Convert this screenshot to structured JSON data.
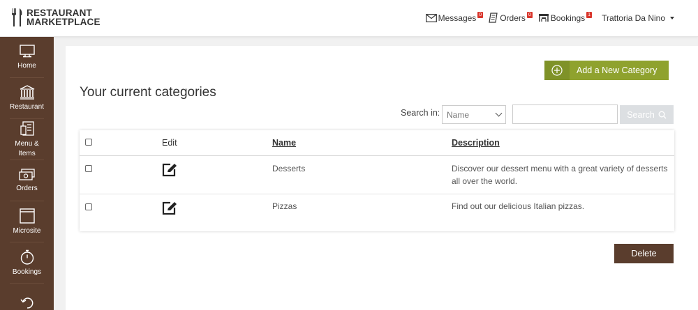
{
  "brand": {
    "line1": "RESTAURANT",
    "line2": "MARKETPLACE"
  },
  "topnav": {
    "messages": {
      "label": "Messages",
      "count": "0"
    },
    "orders": {
      "label": "Orders",
      "count": "0"
    },
    "bookings": {
      "label": "Bookings",
      "count": "1"
    },
    "user": "Trattoria Da Nino"
  },
  "sidebar": {
    "items": [
      {
        "label": "Home",
        "icon": "monitor-icon"
      },
      {
        "label": "Restaurant",
        "icon": "building-icon"
      },
      {
        "label": "Menu &",
        "label2": "Items",
        "icon": "menu-book-icon"
      },
      {
        "label": "Orders",
        "icon": "cash-icon"
      },
      {
        "label": "Microsite",
        "icon": "window-icon"
      },
      {
        "label": "Bookings",
        "icon": "stopwatch-icon"
      }
    ]
  },
  "main": {
    "add_button": "Add a New Category",
    "title": "Your current categories",
    "search": {
      "label": "Search in:",
      "selected": "Name",
      "input_value": "",
      "button": "Search"
    },
    "table": {
      "headers": {
        "edit": "Edit",
        "name": "Name",
        "description": "Description"
      },
      "rows": [
        {
          "name": "Desserts",
          "description": "Discover our dessert menu with a great variety of desserts all over the world."
        },
        {
          "name": "Pizzas",
          "description": "Find out our delicious Italian pizzas."
        }
      ]
    },
    "delete_button": "Delete"
  },
  "colors": {
    "sidebar": "#5a3d2d",
    "accent_green": "#8fa22e",
    "badge_red": "#d9362c",
    "delete_brown": "#5a3d2d"
  }
}
